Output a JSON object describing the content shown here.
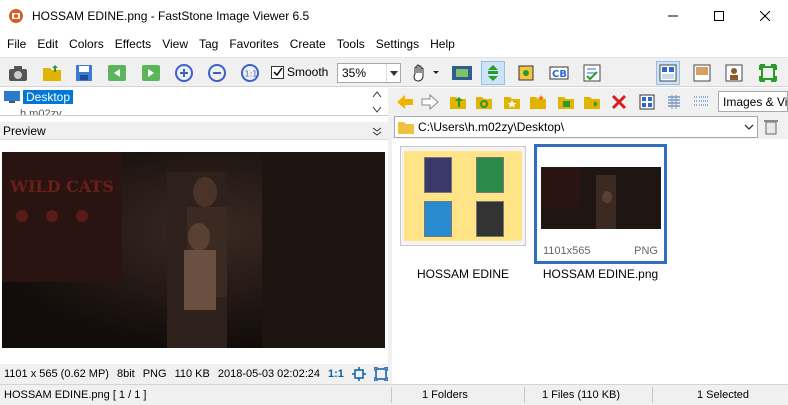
{
  "window": {
    "title": "HOSSAM EDINE.png  -  FastStone Image Viewer 6.5"
  },
  "menu": [
    "File",
    "Edit",
    "Colors",
    "Effects",
    "View",
    "Tag",
    "Favorites",
    "Create",
    "Tools",
    "Settings",
    "Help"
  ],
  "toolbar": {
    "smooth_label": "Smooth",
    "smooth_checked": true,
    "zoom_value": "35%"
  },
  "tree": {
    "selected": "Desktop",
    "partial": "h.m02zy"
  },
  "preview": {
    "header": "Preview",
    "info": {
      "dimensions": "1101 x 565 (0.62 MP)",
      "bitdepth": "8bit",
      "format": "PNG",
      "size": "110 KB",
      "datetime": "2018-05-03 02:02:24",
      "ratio": "1:1"
    }
  },
  "browser": {
    "filter": "Images & Video",
    "path": "C:\\Users\\h.m02zy\\Desktop\\",
    "items": [
      {
        "name": "HOSSAM EDINE",
        "type": "folder"
      },
      {
        "name": "HOSSAM EDINE.png",
        "dims": "1101x565",
        "format": "PNG",
        "selected": true
      }
    ]
  },
  "status": {
    "file": "HOSSAM EDINE.png [ 1 / 1 ]",
    "folders": "1 Folders",
    "files": "1 Files (110 KB)",
    "selected": "1 Selected"
  },
  "colors": {
    "selection": "#0078d7",
    "thumb_border": "#2f6ec0",
    "folder_art": "#ffe487"
  }
}
